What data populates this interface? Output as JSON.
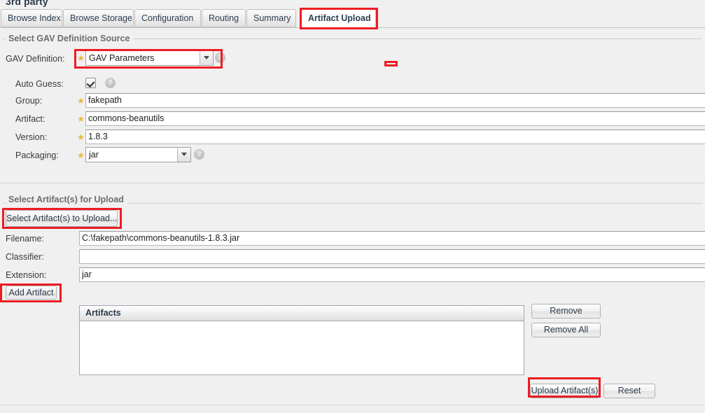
{
  "page": {
    "heading": "3rd party",
    "accent_red": "#ed1c24",
    "background": "#f0f0f0"
  },
  "tabs": [
    {
      "label": "Browse Index",
      "active": false
    },
    {
      "label": "Browse Storage",
      "active": false
    },
    {
      "label": "Configuration",
      "active": false
    },
    {
      "label": "Routing",
      "active": false
    },
    {
      "label": "Summary",
      "active": false
    },
    {
      "label": "Artifact Upload",
      "active": true
    }
  ],
  "gav_section": {
    "legend": "Select GAV Definition Source",
    "gav_definition": {
      "label": "GAV Definition:",
      "required_marker": "★",
      "value": "GAV Parameters",
      "help_glyph": "?"
    },
    "auto_guess": {
      "label": "Auto Guess:",
      "checked": true,
      "help_glyph": "?"
    },
    "fields": [
      {
        "label": "Group:",
        "value": "fakepath",
        "required": true
      },
      {
        "label": "Artifact:",
        "value": "commons-beanutils",
        "required": true
      },
      {
        "label": "Version:",
        "value": "1.8.3",
        "required": true
      }
    ],
    "packaging": {
      "label": "Packaging:",
      "value": "jar",
      "required": true,
      "help_glyph": "?"
    }
  },
  "artifact_section": {
    "legend": "Select Artifact(s) for Upload",
    "select_button": "Select Artifact(s) to Upload...",
    "fields": [
      {
        "label": "Filename:",
        "value": "C:\\fakepath\\commons-beanutils-1.8.3.jar"
      },
      {
        "label": "Classifier:",
        "value": ""
      },
      {
        "label": "Extension:",
        "value": "jar"
      }
    ],
    "add_button": "Add Artifact",
    "grid": {
      "header": "Artifacts",
      "rows": []
    },
    "remove_button": "Remove",
    "remove_all_button": "Remove All",
    "upload_button": "Upload Artifact(s)",
    "reset_button": "Reset"
  }
}
